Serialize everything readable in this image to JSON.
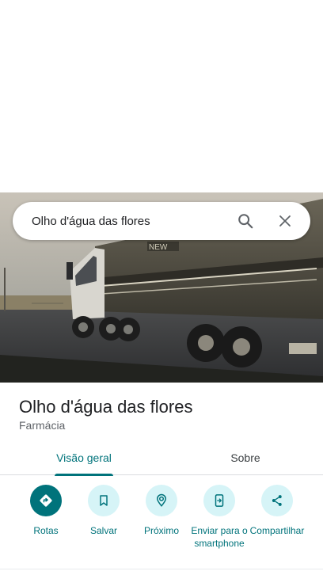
{
  "search": {
    "query": "Olho d'água das flores"
  },
  "place": {
    "title": "Olho d'água das flores",
    "category": "Farmácia"
  },
  "tabs": [
    {
      "label": "Visão geral",
      "active": true
    },
    {
      "label": "Sobre",
      "active": false
    }
  ],
  "actions": [
    {
      "label": "Rotas",
      "icon": "directions-icon"
    },
    {
      "label": "Salvar",
      "icon": "bookmark-icon"
    },
    {
      "label": "Próximo",
      "icon": "nearby-icon"
    },
    {
      "label": "Enviar para o smartphone",
      "icon": "send-to-phone-icon"
    },
    {
      "label": "Compartilhar",
      "icon": "share-icon"
    }
  ],
  "photo": {
    "overlay_text": "NEW"
  },
  "colors": {
    "accent": "#00737b",
    "accent_light": "#d6f4f7",
    "text_primary": "#202124",
    "text_secondary": "#5f6368"
  }
}
